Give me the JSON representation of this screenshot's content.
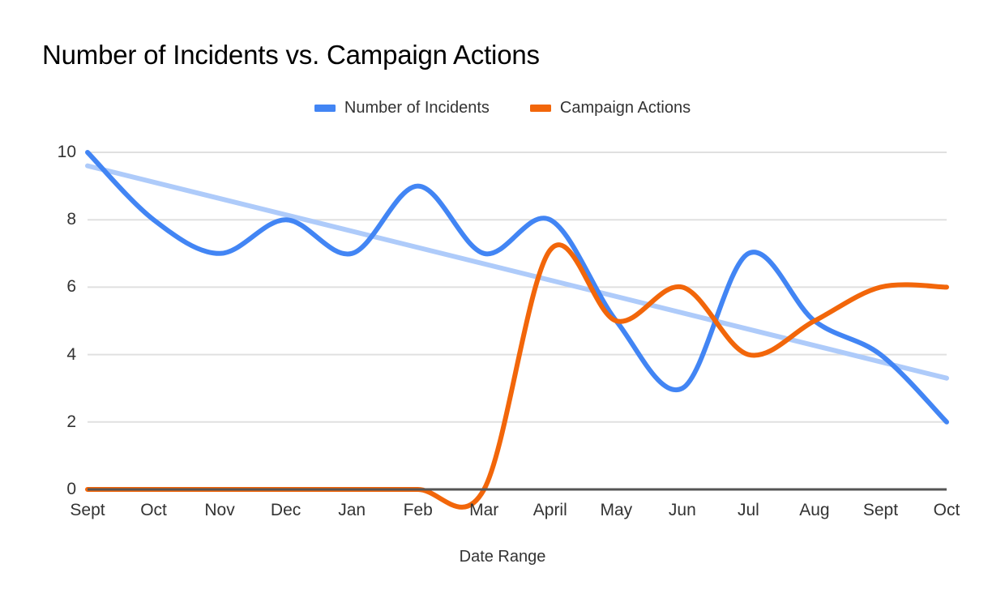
{
  "chart_data": {
    "type": "line",
    "title": "Number of Incidents vs. Campaign Actions",
    "xlabel": "Date Range",
    "ylabel": "",
    "categories": [
      "Sept",
      "Oct",
      "Nov",
      "Dec",
      "Jan",
      "Feb",
      "Mar",
      "April",
      "May",
      "Jun",
      "Jul",
      "Aug",
      "Sept",
      "Oct"
    ],
    "series": [
      {
        "name": "Number of Incidents",
        "color": "#4285F4",
        "values": [
          10,
          8,
          7,
          8,
          7,
          9,
          7,
          8,
          5,
          3,
          7,
          5,
          4,
          2
        ]
      },
      {
        "name": "Campaign Actions",
        "color": "#F2660A",
        "values": [
          0,
          0,
          0,
          0,
          0,
          0,
          0,
          7.1,
          5,
          6,
          4,
          5,
          6,
          6
        ]
      }
    ],
    "trendline": {
      "name": "Number of Incidents trendline",
      "color": "#AECBFA",
      "of_series": "Number of Incidents",
      "start_value": 9.6,
      "end_value": 3.3
    },
    "ylim": [
      0,
      10
    ],
    "yticks": [
      0,
      2,
      4,
      6,
      8,
      10
    ],
    "ytick_labels": [
      "0",
      "2",
      "4",
      "6",
      "8",
      "10"
    ],
    "grid": true,
    "grid_color": "#E0E0E0",
    "axis_color": "#555555",
    "legend_position": "top-center",
    "smoothing": "curved",
    "background": "#FFFFFF"
  },
  "legend": {
    "entries": [
      {
        "label": "Number of Incidents",
        "color": "#4285F4"
      },
      {
        "label": "Campaign Actions",
        "color": "#F2660A"
      }
    ]
  }
}
